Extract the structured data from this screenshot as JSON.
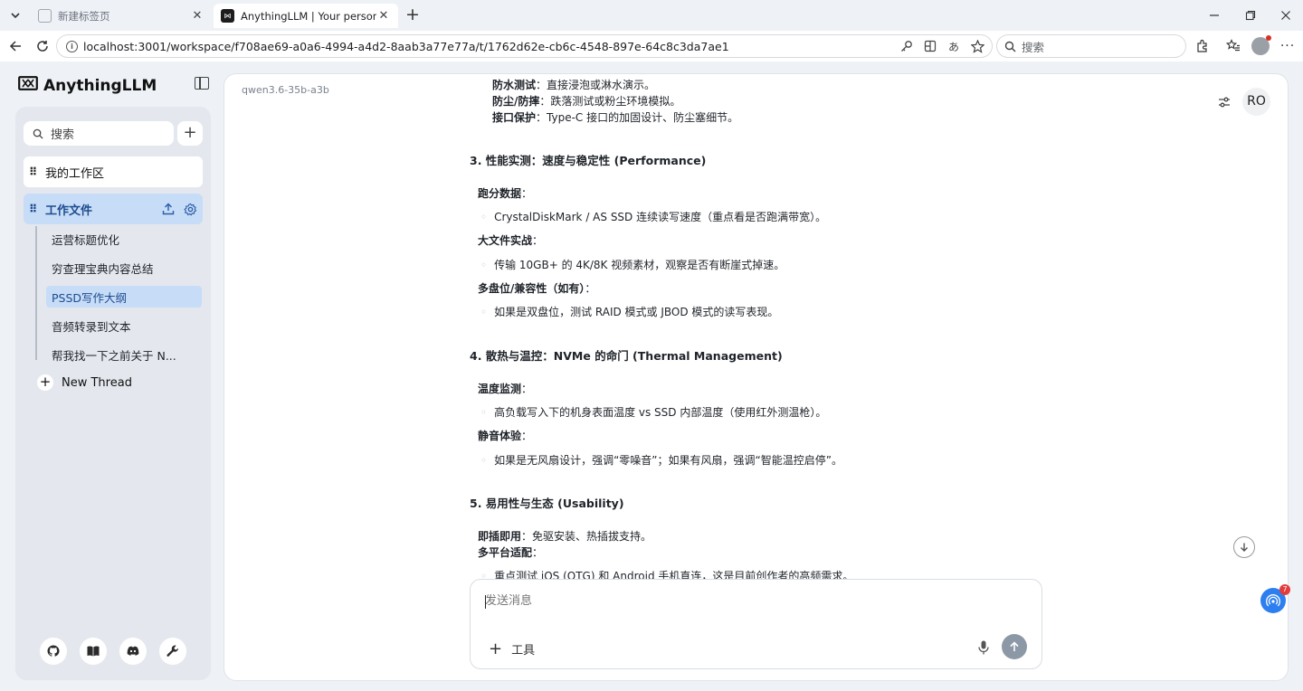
{
  "browser": {
    "tabs": [
      {
        "title": "新建标签页",
        "active": false
      },
      {
        "title": "AnythingLLM | Your personal LLM",
        "active": true
      }
    ],
    "url": "localhost:3001/workspace/f708ae69-a0a6-4994-a4d2-8aab3a77e77a/t/1762d62e-cb6c-4548-897e-64c8c3da7ae1",
    "search_placeholder": "搜索"
  },
  "app": {
    "brand": "AnythingLLM",
    "sidebar": {
      "search_placeholder": "搜索",
      "workspaces": [
        {
          "label": "我的工作区"
        },
        {
          "label": "工作文件"
        }
      ],
      "threads": [
        {
          "label": "运营标题优化"
        },
        {
          "label": "穷查理宝典内容总结"
        },
        {
          "label": "PSSD写作大纲"
        },
        {
          "label": "音频转录到文本"
        },
        {
          "label": "帮我找一下之前关于 N..."
        }
      ],
      "new_thread": "New Thread",
      "footer_icons": [
        "github-icon",
        "book-icon",
        "discord-icon",
        "wrench-icon"
      ]
    },
    "main": {
      "model": "qwen3.6-35b-a3b",
      "user_initials": "RO",
      "lines": [
        {
          "k": "防水测试",
          "v": "：直接浸泡或淋水演示。"
        },
        {
          "k": "防尘/防摔",
          "v": "：跌落测试或粉尘环境模拟。"
        },
        {
          "k": "接口保护",
          "v": "：Type-C 接口的加固设计、防尘塞细节。"
        },
        {
          "text": "3. 性能实测：速度与稳定性 (Performance)"
        },
        {
          "k": "跑分数据",
          "v": "："
        },
        {
          "text": "CrystalDiskMark / AS SSD 连续读写速度（重点看是否跑满带宽）。"
        },
        {
          "k": "大文件实战",
          "v": "："
        },
        {
          "text": "传输 10GB+ 的 4K/8K 视频素材，观察是否有断崖式掉速。"
        },
        {
          "k": "多盘位/兼容性（如有）",
          "v": "："
        },
        {
          "text": "如果是双盘位，测试 RAID 模式或 JBOD 模式的读写表现。"
        },
        {
          "text": "4. 散热与温控：NVMe 的命门 (Thermal Management)"
        },
        {
          "k": "温度监测",
          "v": "："
        },
        {
          "text": "高负载写入下的机身表面温度 vs SSD 内部温度（使用红外测温枪）。"
        },
        {
          "k": "静音体验",
          "v": "："
        },
        {
          "text": "如果是无风扇设计，强调“零噪音”；如果有风扇，强调“智能温控启停”。"
        },
        {
          "text": "5. 易用性与生态 (Usability)"
        },
        {
          "k": "即插即用",
          "v": "：免驱安装、热插拔支持。"
        },
        {
          "k": "多平台适配",
          "v": "："
        },
        {
          "text": "重点测试 iOS (OTG) 和 Android 手机直连，这是目前创作者的高频需求。"
        }
      ]
    },
    "composer": {
      "placeholder": "发送消息",
      "tools_label": "工具"
    },
    "notification_count": "7"
  }
}
